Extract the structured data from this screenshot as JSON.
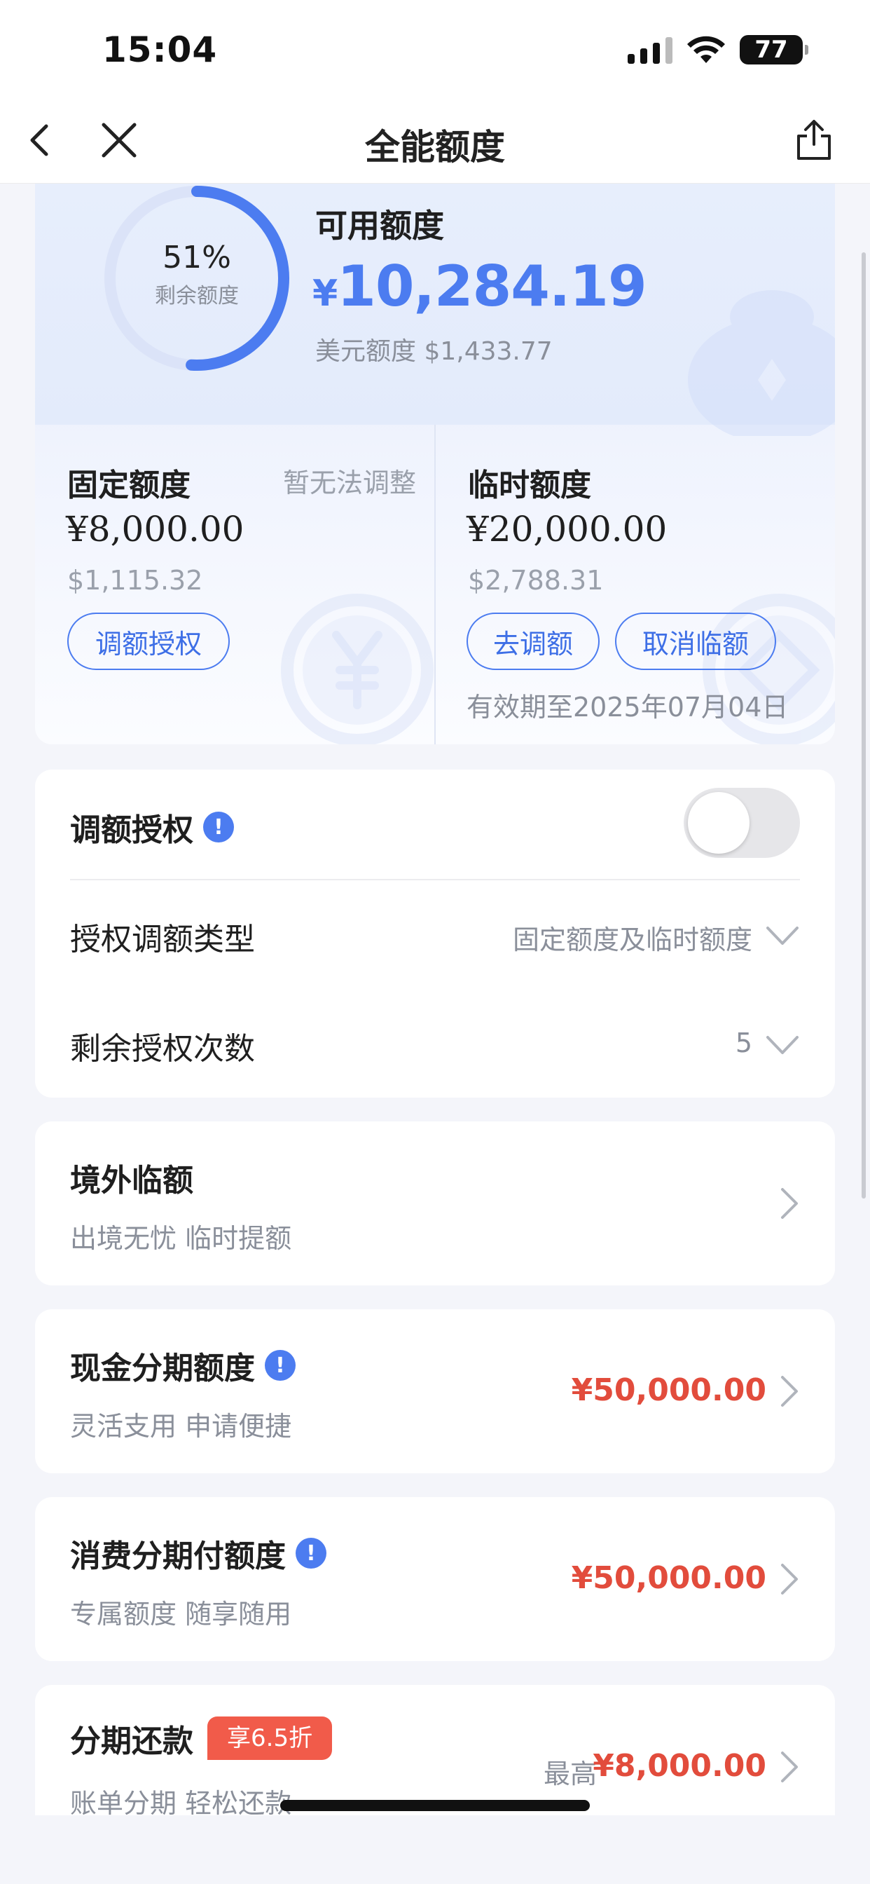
{
  "status_bar": {
    "time": "15:04",
    "battery": "77"
  },
  "nav": {
    "title": "全能额度",
    "icons": [
      "back-icon",
      "close-icon",
      "share-icon"
    ]
  },
  "summary": {
    "ring_percent": "51%",
    "ring_percent_value": 0.51,
    "ring_label": "剩余额度",
    "available_label": "可用额度",
    "available_currency": "¥",
    "available_amount": "10,284.19",
    "usd_line": "美元额度 $1,433.77"
  },
  "fixed_limit": {
    "title": "固定额度",
    "note": "暂无法调整",
    "amount": "¥8,000.00",
    "usd": "$1,115.32",
    "button": "调额授权"
  },
  "temp_limit": {
    "title": "临时额度",
    "amount": "¥20,000.00",
    "usd": "$2,788.31",
    "button_adjust": "去调额",
    "button_cancel": "取消临额",
    "validity": "有效期至2025年07月04日"
  },
  "auth_card": {
    "title": "调额授权",
    "toggle_on": false,
    "type_label": "授权调额类型",
    "type_value": "固定额度及临时额度",
    "count_label": "剩余授权次数",
    "count_value": "5"
  },
  "overseas": {
    "title": "境外临额",
    "subtitle": "出境无忧 临时提额"
  },
  "cash_installment": {
    "title": "现金分期额度",
    "subtitle": "灵活支用 申请便捷",
    "amount": "¥50,000.00"
  },
  "consumer_installment": {
    "title": "消费分期付额度",
    "subtitle": "专属额度 随享随用",
    "amount": "¥50,000.00"
  },
  "repay_installment": {
    "title": "分期还款",
    "tag": "享6.5折",
    "subtitle": "账单分期 轻松还款",
    "max_label": "最高",
    "amount": "¥8,000.00"
  },
  "colors": {
    "accent": "#4c7cf0",
    "red": "#e24c3c",
    "promo": "#f15b4a"
  }
}
